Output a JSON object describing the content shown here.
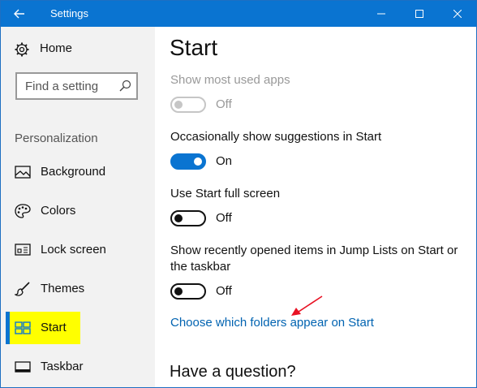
{
  "window": {
    "title": "Settings"
  },
  "sidebar": {
    "home_label": "Home",
    "search_placeholder": "Find a setting",
    "section_label": "Personalization",
    "items": [
      {
        "label": "Background",
        "icon": "picture-icon"
      },
      {
        "label": "Colors",
        "icon": "palette-icon"
      },
      {
        "label": "Lock screen",
        "icon": "lock-screen-icon"
      },
      {
        "label": "Themes",
        "icon": "brush-icon"
      },
      {
        "label": "Start",
        "icon": "start-tiles-icon",
        "selected": true
      },
      {
        "label": "Taskbar",
        "icon": "taskbar-icon"
      }
    ]
  },
  "main": {
    "title": "Start",
    "settings": [
      {
        "label": "Show most used apps",
        "state": "Off",
        "disabled": true
      },
      {
        "label": "Occasionally show suggestions in Start",
        "state": "On",
        "disabled": false
      },
      {
        "label": "Use Start full screen",
        "state": "Off",
        "disabled": false
      },
      {
        "label": "Show recently opened items in Jump Lists on Start or the taskbar",
        "state": "Off",
        "disabled": false
      }
    ],
    "link_label": "Choose which folders appear on Start",
    "question_heading": "Have a question?"
  },
  "colors": {
    "accent": "#0a74d1",
    "highlight": "#ffff00",
    "annotation_arrow": "#e81123",
    "link": "#0063b1"
  }
}
